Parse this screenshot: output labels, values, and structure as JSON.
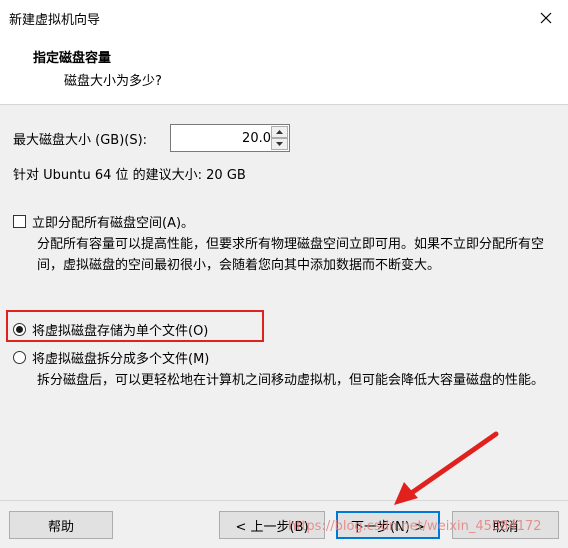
{
  "window": {
    "title": "新建虚拟机向导"
  },
  "header": {
    "title": "指定磁盘容量",
    "subtitle": "磁盘大小为多少?"
  },
  "disk_size": {
    "label": "最大磁盘大小 (GB)(S):",
    "value": "20.0",
    "recommendation": "针对 Ubuntu 64 位 的建议大小: 20 GB"
  },
  "allocate": {
    "label": "立即分配所有磁盘空间(A)。",
    "checked": false,
    "description": "分配所有容量可以提高性能，但要求所有物理磁盘空间立即可用。如果不立即分配所有空间，虚拟磁盘的空间最初很小，会随着您向其中添加数据而不断变大。"
  },
  "storage_options": [
    {
      "label": "将虚拟磁盘存储为单个文件(O)",
      "selected": true
    },
    {
      "label": "将虚拟磁盘拆分成多个文件(M)",
      "selected": false,
      "description": "拆分磁盘后，可以更轻松地在计算机之间移动虚拟机，但可能会降低大容量磁盘的性能。"
    }
  ],
  "buttons": {
    "help": "帮助",
    "back": "< 上一步(B)",
    "next": "下一步(N) >",
    "cancel": "取消"
  },
  "watermark": "https://blog.csdn.net/weixin_45084172",
  "colors": {
    "highlight": "#e0211d",
    "primary_border": "#0078d7",
    "arrow": "#e0211d"
  }
}
